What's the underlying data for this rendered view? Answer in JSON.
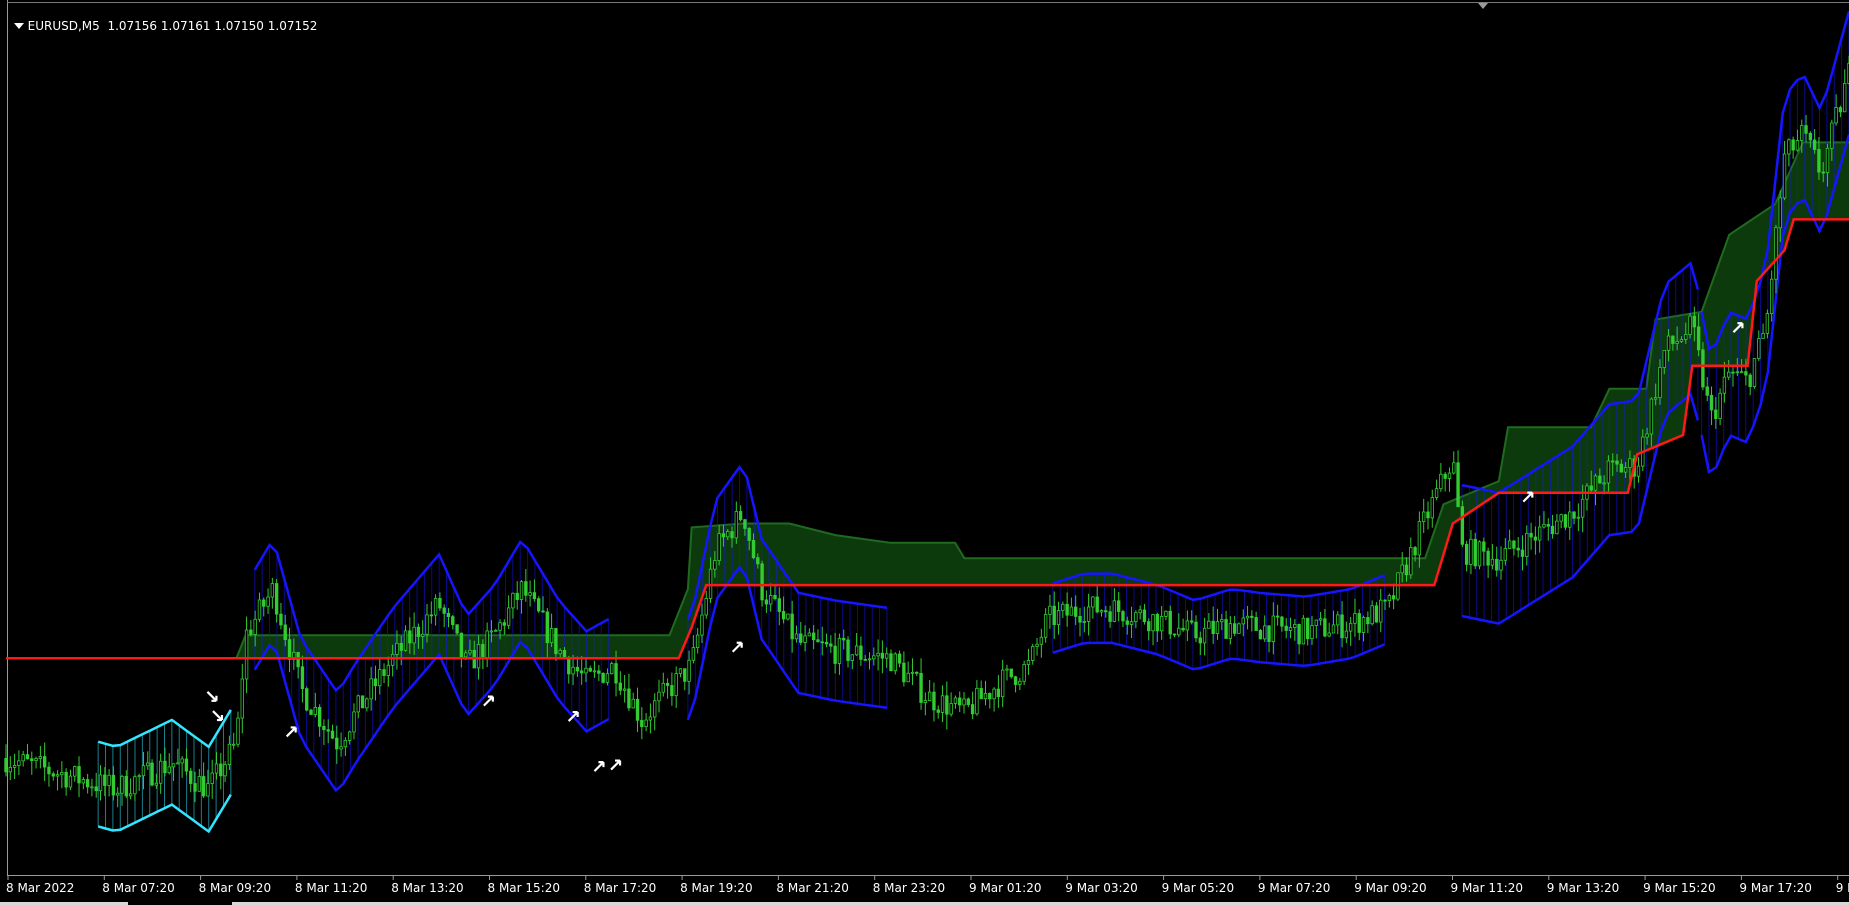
{
  "header": {
    "symbol": "EURUSD,M5",
    "prices": "1.07156 1.07161 1.07150 1.07152"
  },
  "colors": {
    "background": "#000000",
    "candle": "#33cc33",
    "channel": "#1515ff",
    "channel_fill": "#1d2a9a",
    "lower_channel": "#33e6ff",
    "stop_line": "#ff1a1a",
    "cloud": "#0d3a0d",
    "cloud_edge": "#1f6a1f",
    "signal": "#ffffff",
    "axis_text": "#ffffff"
  },
  "chart_data": {
    "type": "candlestick",
    "timeframe": "M5",
    "x_tick_labels": [
      "8 Mar 2022",
      "8 Mar 07:20",
      "8 Mar 09:20",
      "8 Mar 11:20",
      "8 Mar 13:20",
      "8 Mar 15:20",
      "8 Mar 17:20",
      "8 Mar 19:20",
      "8 Mar 21:20",
      "8 Mar 23:20",
      "9 Mar 01:20",
      "9 Mar 03:20",
      "9 Mar 05:20",
      "9 Mar 07:20",
      "9 Mar 09:20",
      "9 Mar 11:20",
      "9 Mar 13:20",
      "9 Mar 15:20",
      "9 Mar 17:20",
      "9 M"
    ],
    "price_path": [
      [
        0.0,
        0.08
      ],
      [
        0.03,
        0.06
      ],
      [
        0.06,
        0.04
      ],
      [
        0.09,
        0.075
      ],
      [
        0.11,
        0.04
      ],
      [
        0.125,
        0.1
      ],
      [
        0.13,
        0.24
      ],
      [
        0.145,
        0.3
      ],
      [
        0.16,
        0.17
      ],
      [
        0.18,
        0.1
      ],
      [
        0.19,
        0.14
      ],
      [
        0.21,
        0.21
      ],
      [
        0.235,
        0.28
      ],
      [
        0.25,
        0.2
      ],
      [
        0.265,
        0.24
      ],
      [
        0.28,
        0.3
      ],
      [
        0.3,
        0.22
      ],
      [
        0.315,
        0.18
      ],
      [
        0.33,
        0.2
      ],
      [
        0.345,
        0.13
      ],
      [
        0.36,
        0.17
      ],
      [
        0.372,
        0.2
      ],
      [
        0.385,
        0.35
      ],
      [
        0.4,
        0.4
      ],
      [
        0.41,
        0.3
      ],
      [
        0.43,
        0.23
      ],
      [
        0.45,
        0.22
      ],
      [
        0.48,
        0.21
      ],
      [
        0.5,
        0.16
      ],
      [
        0.52,
        0.14
      ],
      [
        0.54,
        0.18
      ],
      [
        0.555,
        0.2
      ],
      [
        0.565,
        0.26
      ],
      [
        0.585,
        0.275
      ],
      [
        0.6,
        0.275
      ],
      [
        0.625,
        0.26
      ],
      [
        0.645,
        0.24
      ],
      [
        0.665,
        0.255
      ],
      [
        0.68,
        0.25
      ],
      [
        0.705,
        0.245
      ],
      [
        0.73,
        0.255
      ],
      [
        0.75,
        0.275
      ],
      [
        0.77,
        0.39
      ],
      [
        0.785,
        0.47
      ],
      [
        0.79,
        0.35
      ],
      [
        0.81,
        0.34
      ],
      [
        0.83,
        0.37
      ],
      [
        0.85,
        0.4
      ],
      [
        0.87,
        0.455
      ],
      [
        0.885,
        0.46
      ],
      [
        0.9,
        0.61
      ],
      [
        0.915,
        0.64
      ],
      [
        0.925,
        0.52
      ],
      [
        0.935,
        0.58
      ],
      [
        0.945,
        0.57
      ],
      [
        0.955,
        0.64
      ],
      [
        0.965,
        0.86
      ],
      [
        0.975,
        0.89
      ],
      [
        0.985,
        0.84
      ],
      [
        1.0,
        0.97
      ]
    ],
    "signals": [
      {
        "x": 0.112,
        "y": 0.16,
        "dir": "down"
      },
      {
        "x": 0.115,
        "y": 0.135,
        "dir": "down"
      },
      {
        "x": 0.155,
        "y": 0.115,
        "dir": "up"
      },
      {
        "x": 0.262,
        "y": 0.155,
        "dir": "up"
      },
      {
        "x": 0.308,
        "y": 0.135,
        "dir": "up"
      },
      {
        "x": 0.322,
        "y": 0.07,
        "dir": "up"
      },
      {
        "x": 0.331,
        "y": 0.072,
        "dir": "up"
      },
      {
        "x": 0.397,
        "y": 0.225,
        "dir": "up"
      },
      {
        "x": 0.826,
        "y": 0.42,
        "dir": "up"
      },
      {
        "x": 0.94,
        "y": 0.64,
        "dir": "up"
      }
    ]
  }
}
